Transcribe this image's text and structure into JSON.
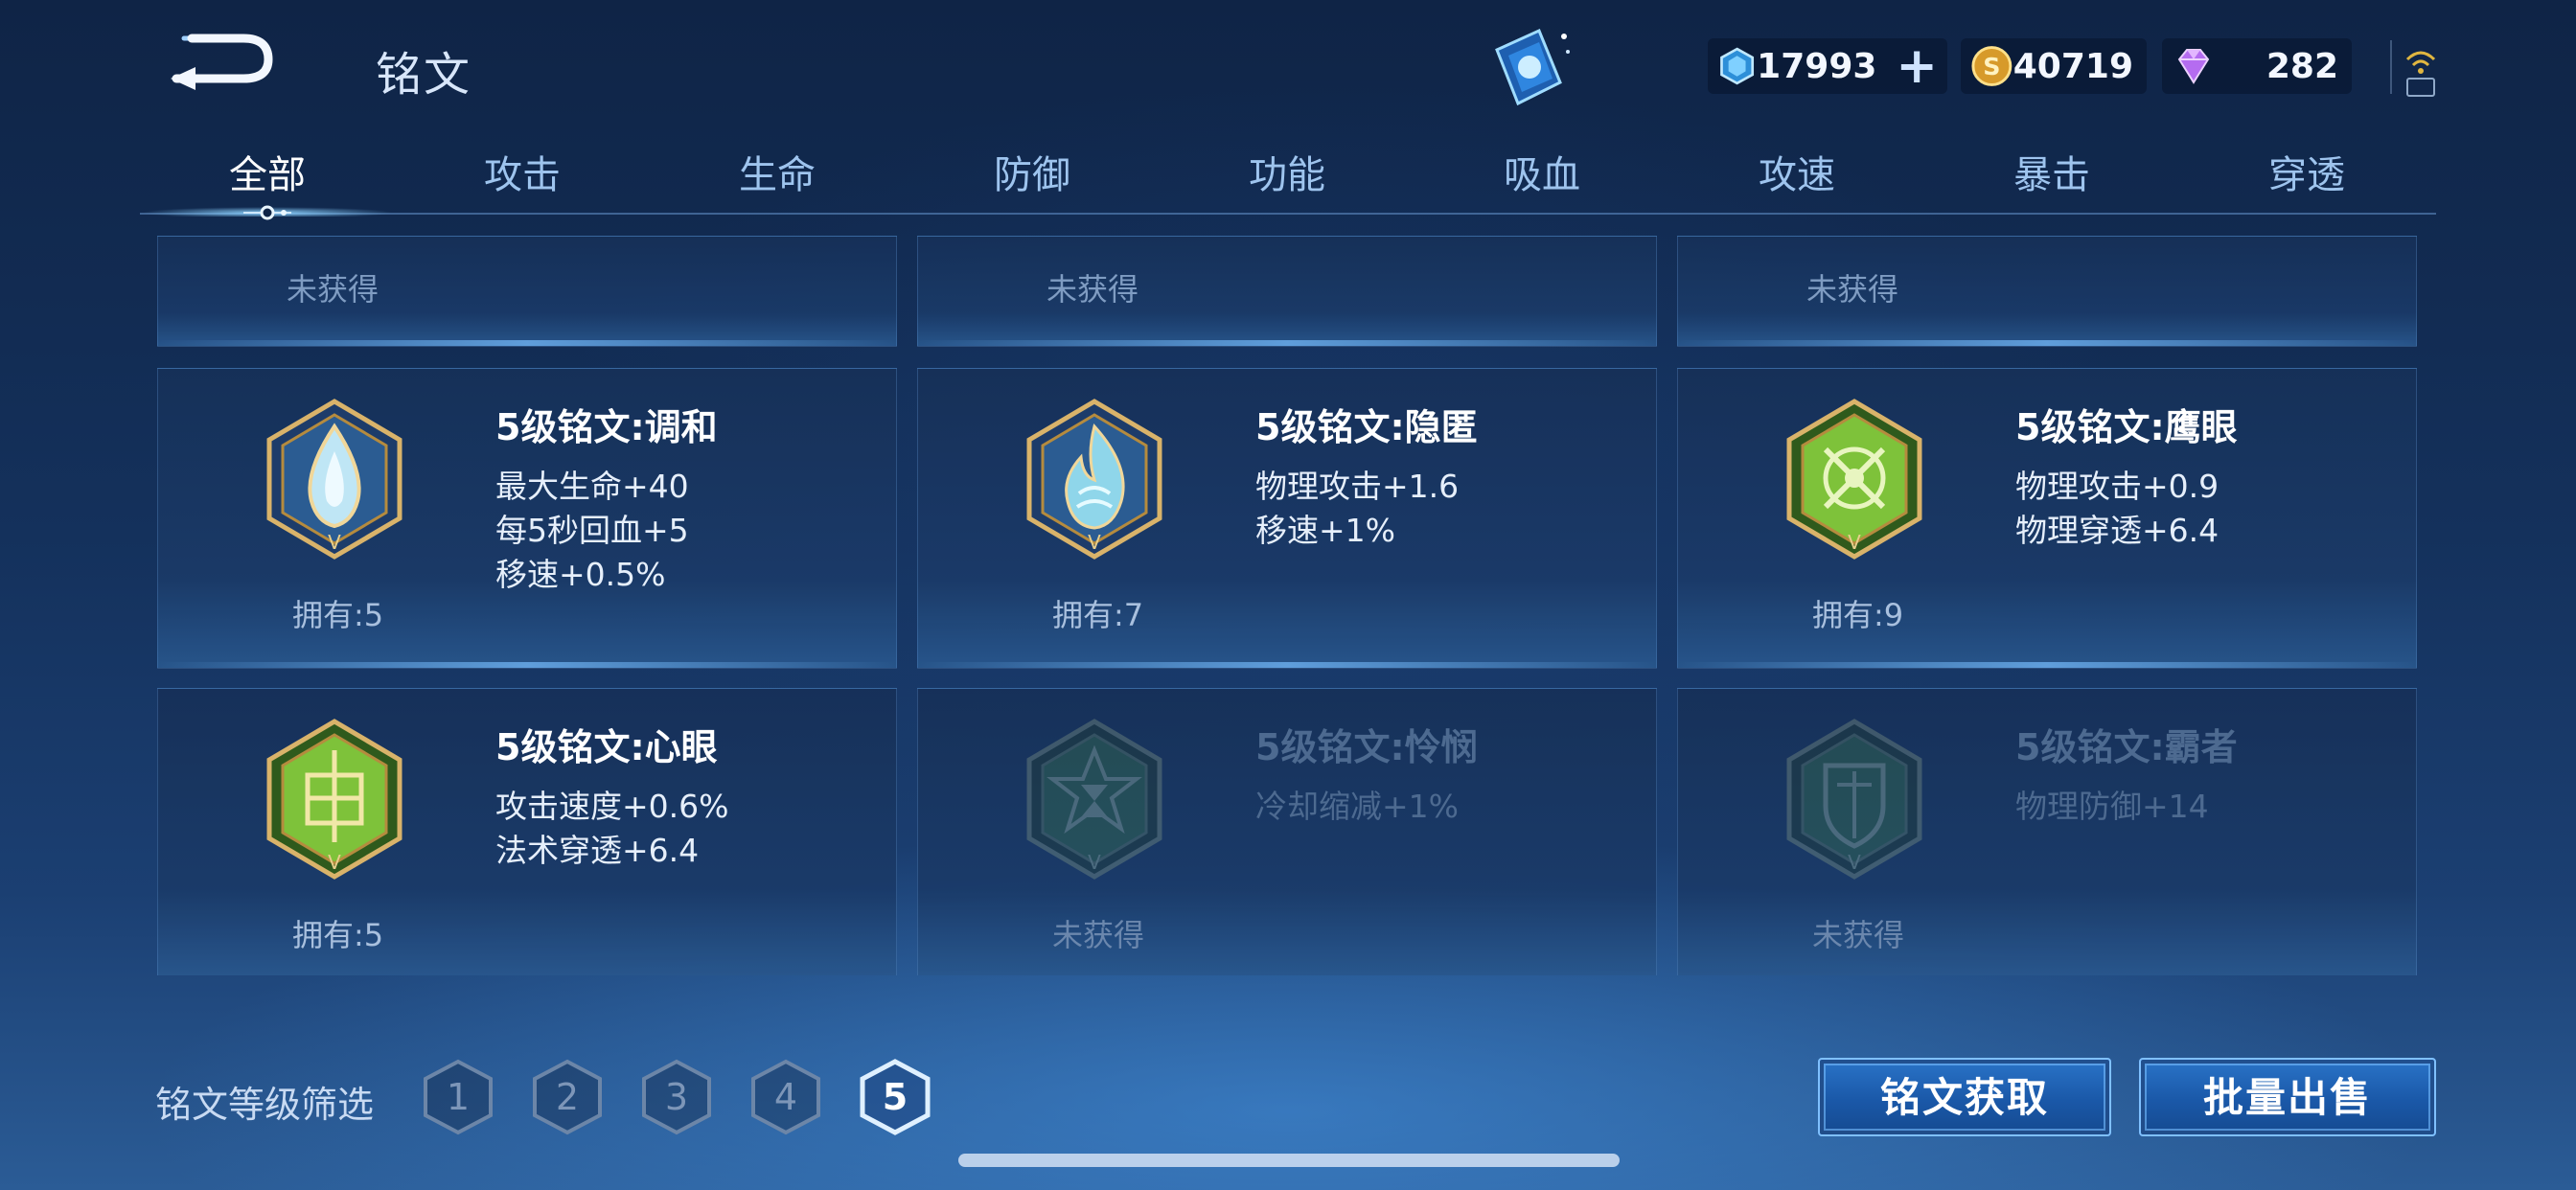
{
  "header": {
    "title": "铭文",
    "currencies": [
      {
        "name": "coupon",
        "value": "17993"
      },
      {
        "name": "gold",
        "value": "40719"
      },
      {
        "name": "gem",
        "value": "282"
      }
    ]
  },
  "tabs": [
    "全部",
    "攻击",
    "生命",
    "防御",
    "功能",
    "吸血",
    "攻速",
    "暴击",
    "穿透"
  ],
  "active_tab": "全部",
  "top_row": [
    {
      "status": "未获得"
    },
    {
      "status": "未获得"
    },
    {
      "status": "未获得"
    }
  ],
  "runes": [
    {
      "title": "5级铭文:调和",
      "stats": [
        "最大生命+40",
        "每5秒回血+5",
        "移速+0.5%"
      ],
      "owned": "拥有:5",
      "color": "#bfe6f5"
    },
    {
      "title": "5级铭文:隐匿",
      "stats": [
        "物理攻击+1.6",
        "移速+1%"
      ],
      "owned": "拥有:7",
      "color": "#8fd6ea"
    },
    {
      "title": "5级铭文:鹰眼",
      "stats": [
        "物理攻击+0.9",
        "物理穿透+6.4"
      ],
      "owned": "拥有:9",
      "color": "#7ec23a"
    },
    {
      "title": "5级铭文:心眼",
      "stats": [
        "攻击速度+0.6%",
        "法术穿透+6.4"
      ],
      "owned": "拥有:5",
      "color": "#7ec23a"
    },
    {
      "title": "5级铭文:怜悯",
      "stats": [
        "冷却缩减+1%"
      ],
      "owned": "未获得",
      "color": "#3c7a4a"
    },
    {
      "title": "5级铭文:霸者",
      "stats": [
        "物理防御+14"
      ],
      "owned": "未获得",
      "color": "#3c7a4a"
    }
  ],
  "footer": {
    "filter_label": "铭文等级筛选",
    "levels": [
      "1",
      "2",
      "3",
      "4",
      "5"
    ],
    "selected_level": "5",
    "acquire_label": "铭文获取",
    "sell_label": "批量出售"
  }
}
